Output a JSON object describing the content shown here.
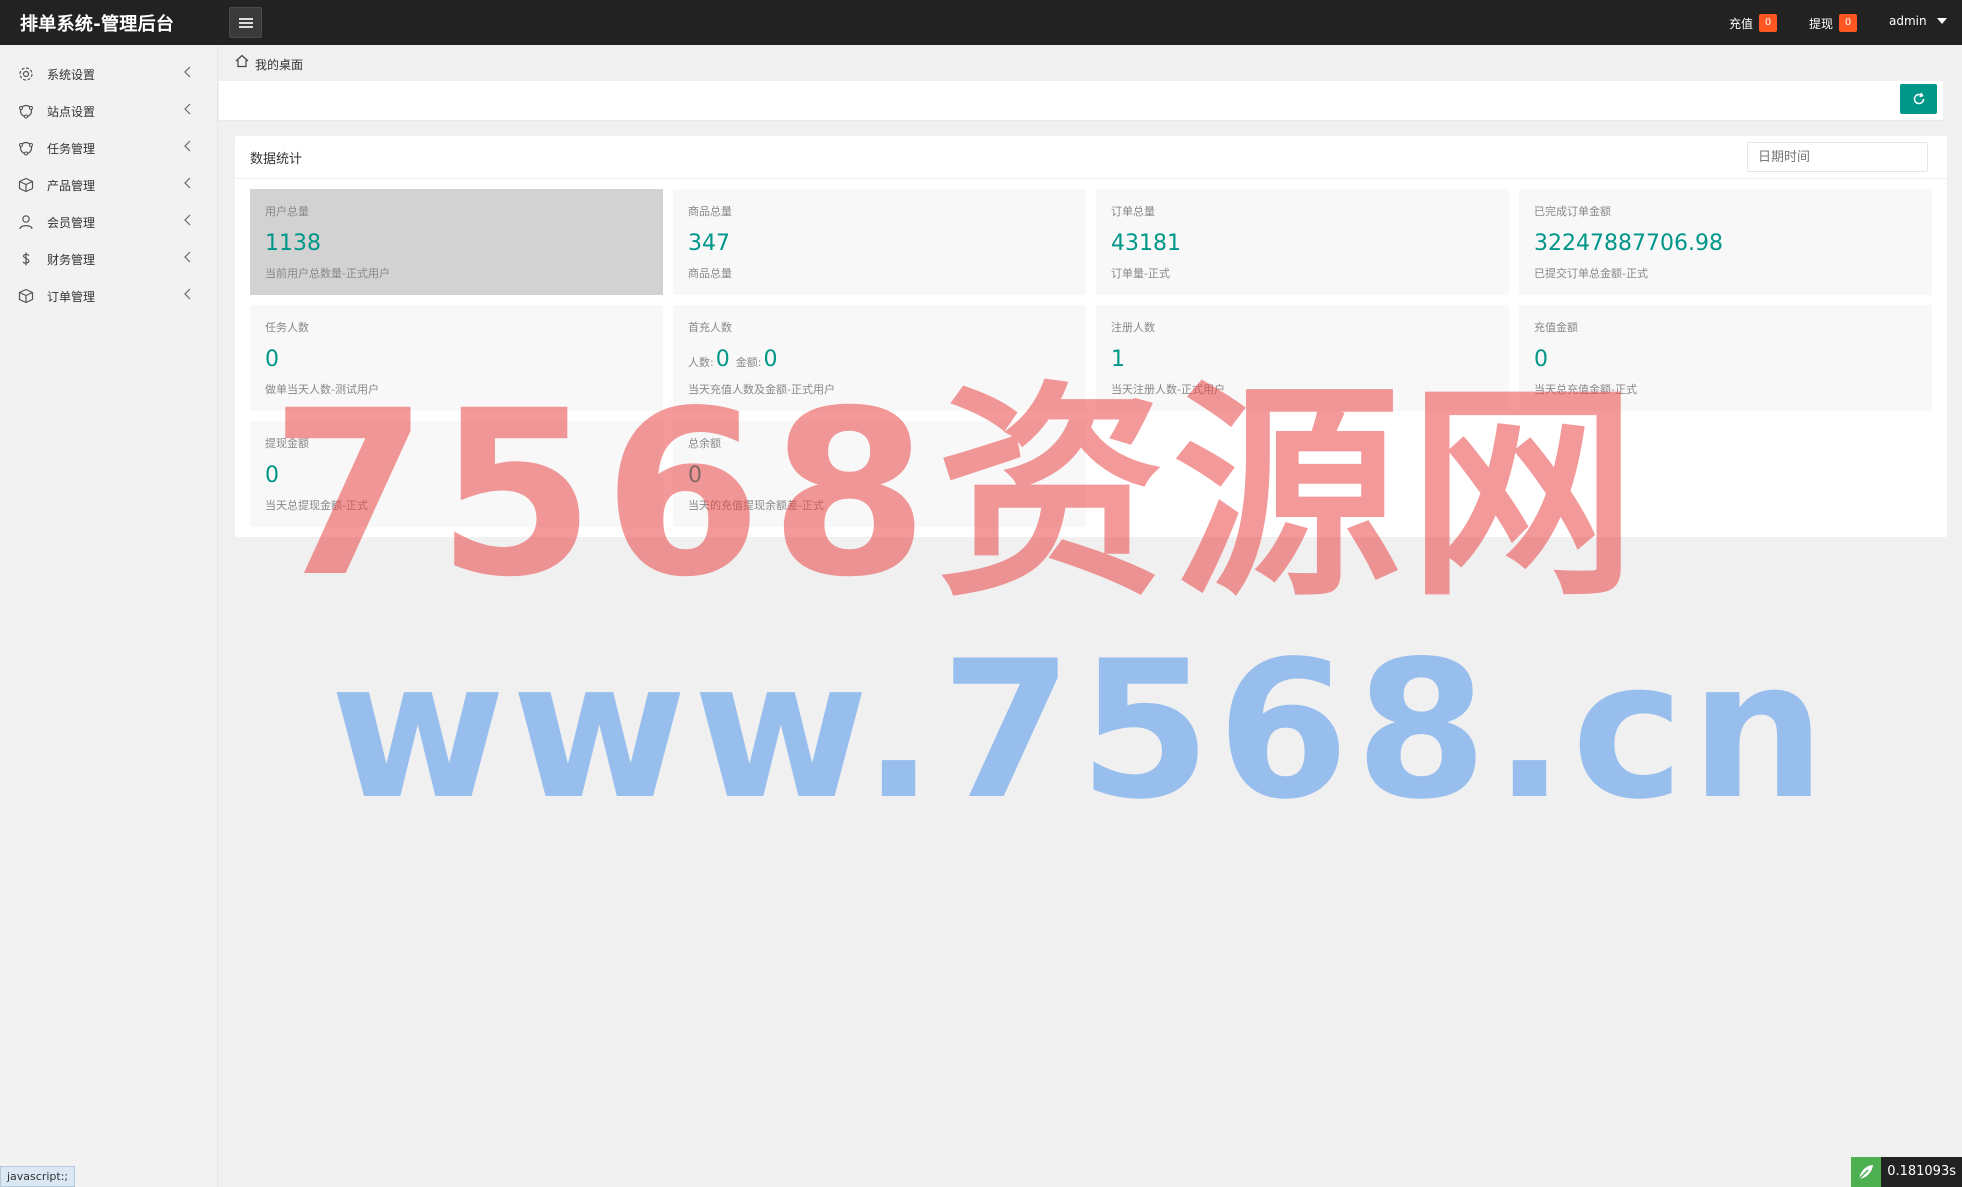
{
  "header": {
    "brand": "排单系统-管理后台",
    "recharge_label": "充值",
    "recharge_count": "0",
    "withdraw_label": "提现",
    "withdraw_count": "0",
    "user": "admin"
  },
  "sidebar": {
    "items": [
      {
        "label": "系统设置",
        "icon": "gear-icon"
      },
      {
        "label": "站点设置",
        "icon": "site-icon"
      },
      {
        "label": "任务管理",
        "icon": "task-icon"
      },
      {
        "label": "产品管理",
        "icon": "box-icon"
      },
      {
        "label": "会员管理",
        "icon": "user-icon"
      },
      {
        "label": "财务管理",
        "icon": "dollar-icon"
      },
      {
        "label": "订单管理",
        "icon": "box-icon"
      }
    ]
  },
  "breadcrumb": {
    "label": "我的桌面"
  },
  "stats_card": {
    "title": "数据统计",
    "date_placeholder": "日期时间",
    "items": [
      {
        "title": "用户总量",
        "value": "1138",
        "desc": "当前用户总数量-正式用户"
      },
      {
        "title": "商品总量",
        "value": "347",
        "desc": "商品总量"
      },
      {
        "title": "订单总量",
        "value": "43181",
        "desc": "订单量-正式"
      },
      {
        "title": "已完成订单金额",
        "value": "32247887706.98",
        "desc": "已提交订单总金额-正式"
      },
      {
        "title": "任务人数",
        "value": "0",
        "desc": "做单当天人数-测试用户"
      },
      {
        "title": "首充人数",
        "people_label": "人数:",
        "people_value": "0",
        "amount_label": "金额:",
        "amount_value": "0",
        "desc": "当天充值人数及金额-正式用户"
      },
      {
        "title": "注册人数",
        "value": "1",
        "desc": "当天注册人数-正式用户"
      },
      {
        "title": "充值金额",
        "value": "0",
        "desc": "当天总充值金额-正式"
      },
      {
        "title": "提现金额",
        "value": "0",
        "desc": "当天总提现金额-正式"
      },
      {
        "title": "总余额",
        "value": "0",
        "desc": "当天的充值提现余额差-正式"
      }
    ]
  },
  "watermark": {
    "line1": "7568资源网",
    "line2": "www.7568.cn"
  },
  "status_tip": "javascript:;",
  "timer": "0.181093s",
  "colors": {
    "accent": "#009688",
    "badge": "#ff5722",
    "topbar": "#222222"
  }
}
